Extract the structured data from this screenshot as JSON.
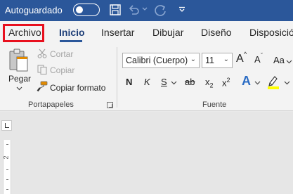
{
  "titlebar": {
    "autosave_label": "Autoguardado",
    "autosave_state": "off",
    "icons": [
      "save-icon",
      "undo-icon",
      "undo-dropdown-icon",
      "redo-icon",
      "customize-qat-icon"
    ],
    "background": "#2b579a"
  },
  "tabs": [
    {
      "label": "Archivo"
    },
    {
      "label": "Inicio",
      "active": true
    },
    {
      "label": "Insertar"
    },
    {
      "label": "Dibujar"
    },
    {
      "label": "Diseño"
    },
    {
      "label": "Disposición"
    }
  ],
  "highlight_color": "#e8101e",
  "clipboard": {
    "paste_label": "Pegar",
    "cut_label": "Cortar",
    "copy_label": "Copiar",
    "format_painter_label": "Copiar formato",
    "group_label": "Portapapeles"
  },
  "font": {
    "font_name": "Calibri (Cuerpo)",
    "font_size": "11",
    "grow_label": "A",
    "shrink_label": "A",
    "case_label": "Aa",
    "bold_label": "N",
    "italic_label": "K",
    "underline_label": "S",
    "strike_label": "ab",
    "subscript_label": "x",
    "subscript_mark": "2",
    "superscript_label": "x",
    "superscript_mark": "2",
    "effects_label": "A",
    "group_label": "Fuente"
  },
  "ruler": {
    "number": "2"
  }
}
